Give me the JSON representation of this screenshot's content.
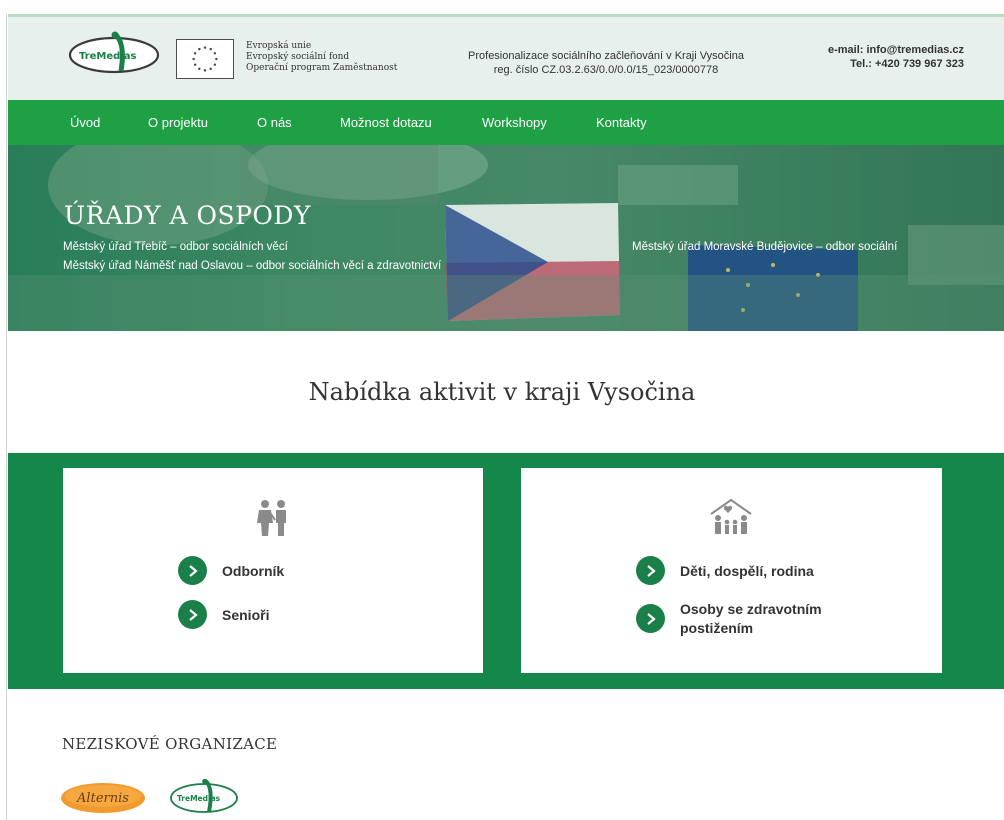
{
  "header": {
    "logo_text": "TreMedias",
    "eu_lines": [
      "Evropská unie",
      "Evropský sociální fond",
      "Operační program Zaměstnanost"
    ],
    "project_line1": "Profesionalizace sociálního začleňování v Kraji Vysočina",
    "project_line2": "reg. číslo CZ.03.2.63/0.0/0.0/15_023/0000778",
    "email": "e-mail: info@tremedias.cz",
    "phone": "Tel.: +420 739 967 323"
  },
  "nav": {
    "items": [
      "Úvod",
      "O projektu",
      "O nás",
      "Možnost dotazu",
      "Workshopy",
      "Kontakty"
    ]
  },
  "hero": {
    "title": "ÚŘADY A OSPODY",
    "links": [
      "Městský úřad Třebíč – odbor sociálních věcí",
      "Městský úřad Náměšť nad Oslavou – odbor sociálních věcí a zdravotnictví",
      "Městský úřad Moravské Budějovice – odbor sociální"
    ]
  },
  "offer": {
    "title": "Nabídka aktivit v kraji Vysočina",
    "left_card": {
      "icon": "people-icon",
      "items": [
        "Odborník",
        "Senioři"
      ]
    },
    "right_card": {
      "icon": "family-house-icon",
      "items": [
        "Děti, dospělí, rodina",
        "Osoby se zdravotním postižením"
      ]
    }
  },
  "ngo": {
    "title": "NEZISKOVÉ ORGANIZACE",
    "logos": [
      "Alternis",
      "TreMedias"
    ]
  },
  "colors": {
    "nav_green": "#1fa045",
    "band_green": "#14874a",
    "header_bg": "#e7f0ec",
    "chevron_green": "#1a7f49",
    "alternis_orange": "#f39a2e"
  }
}
